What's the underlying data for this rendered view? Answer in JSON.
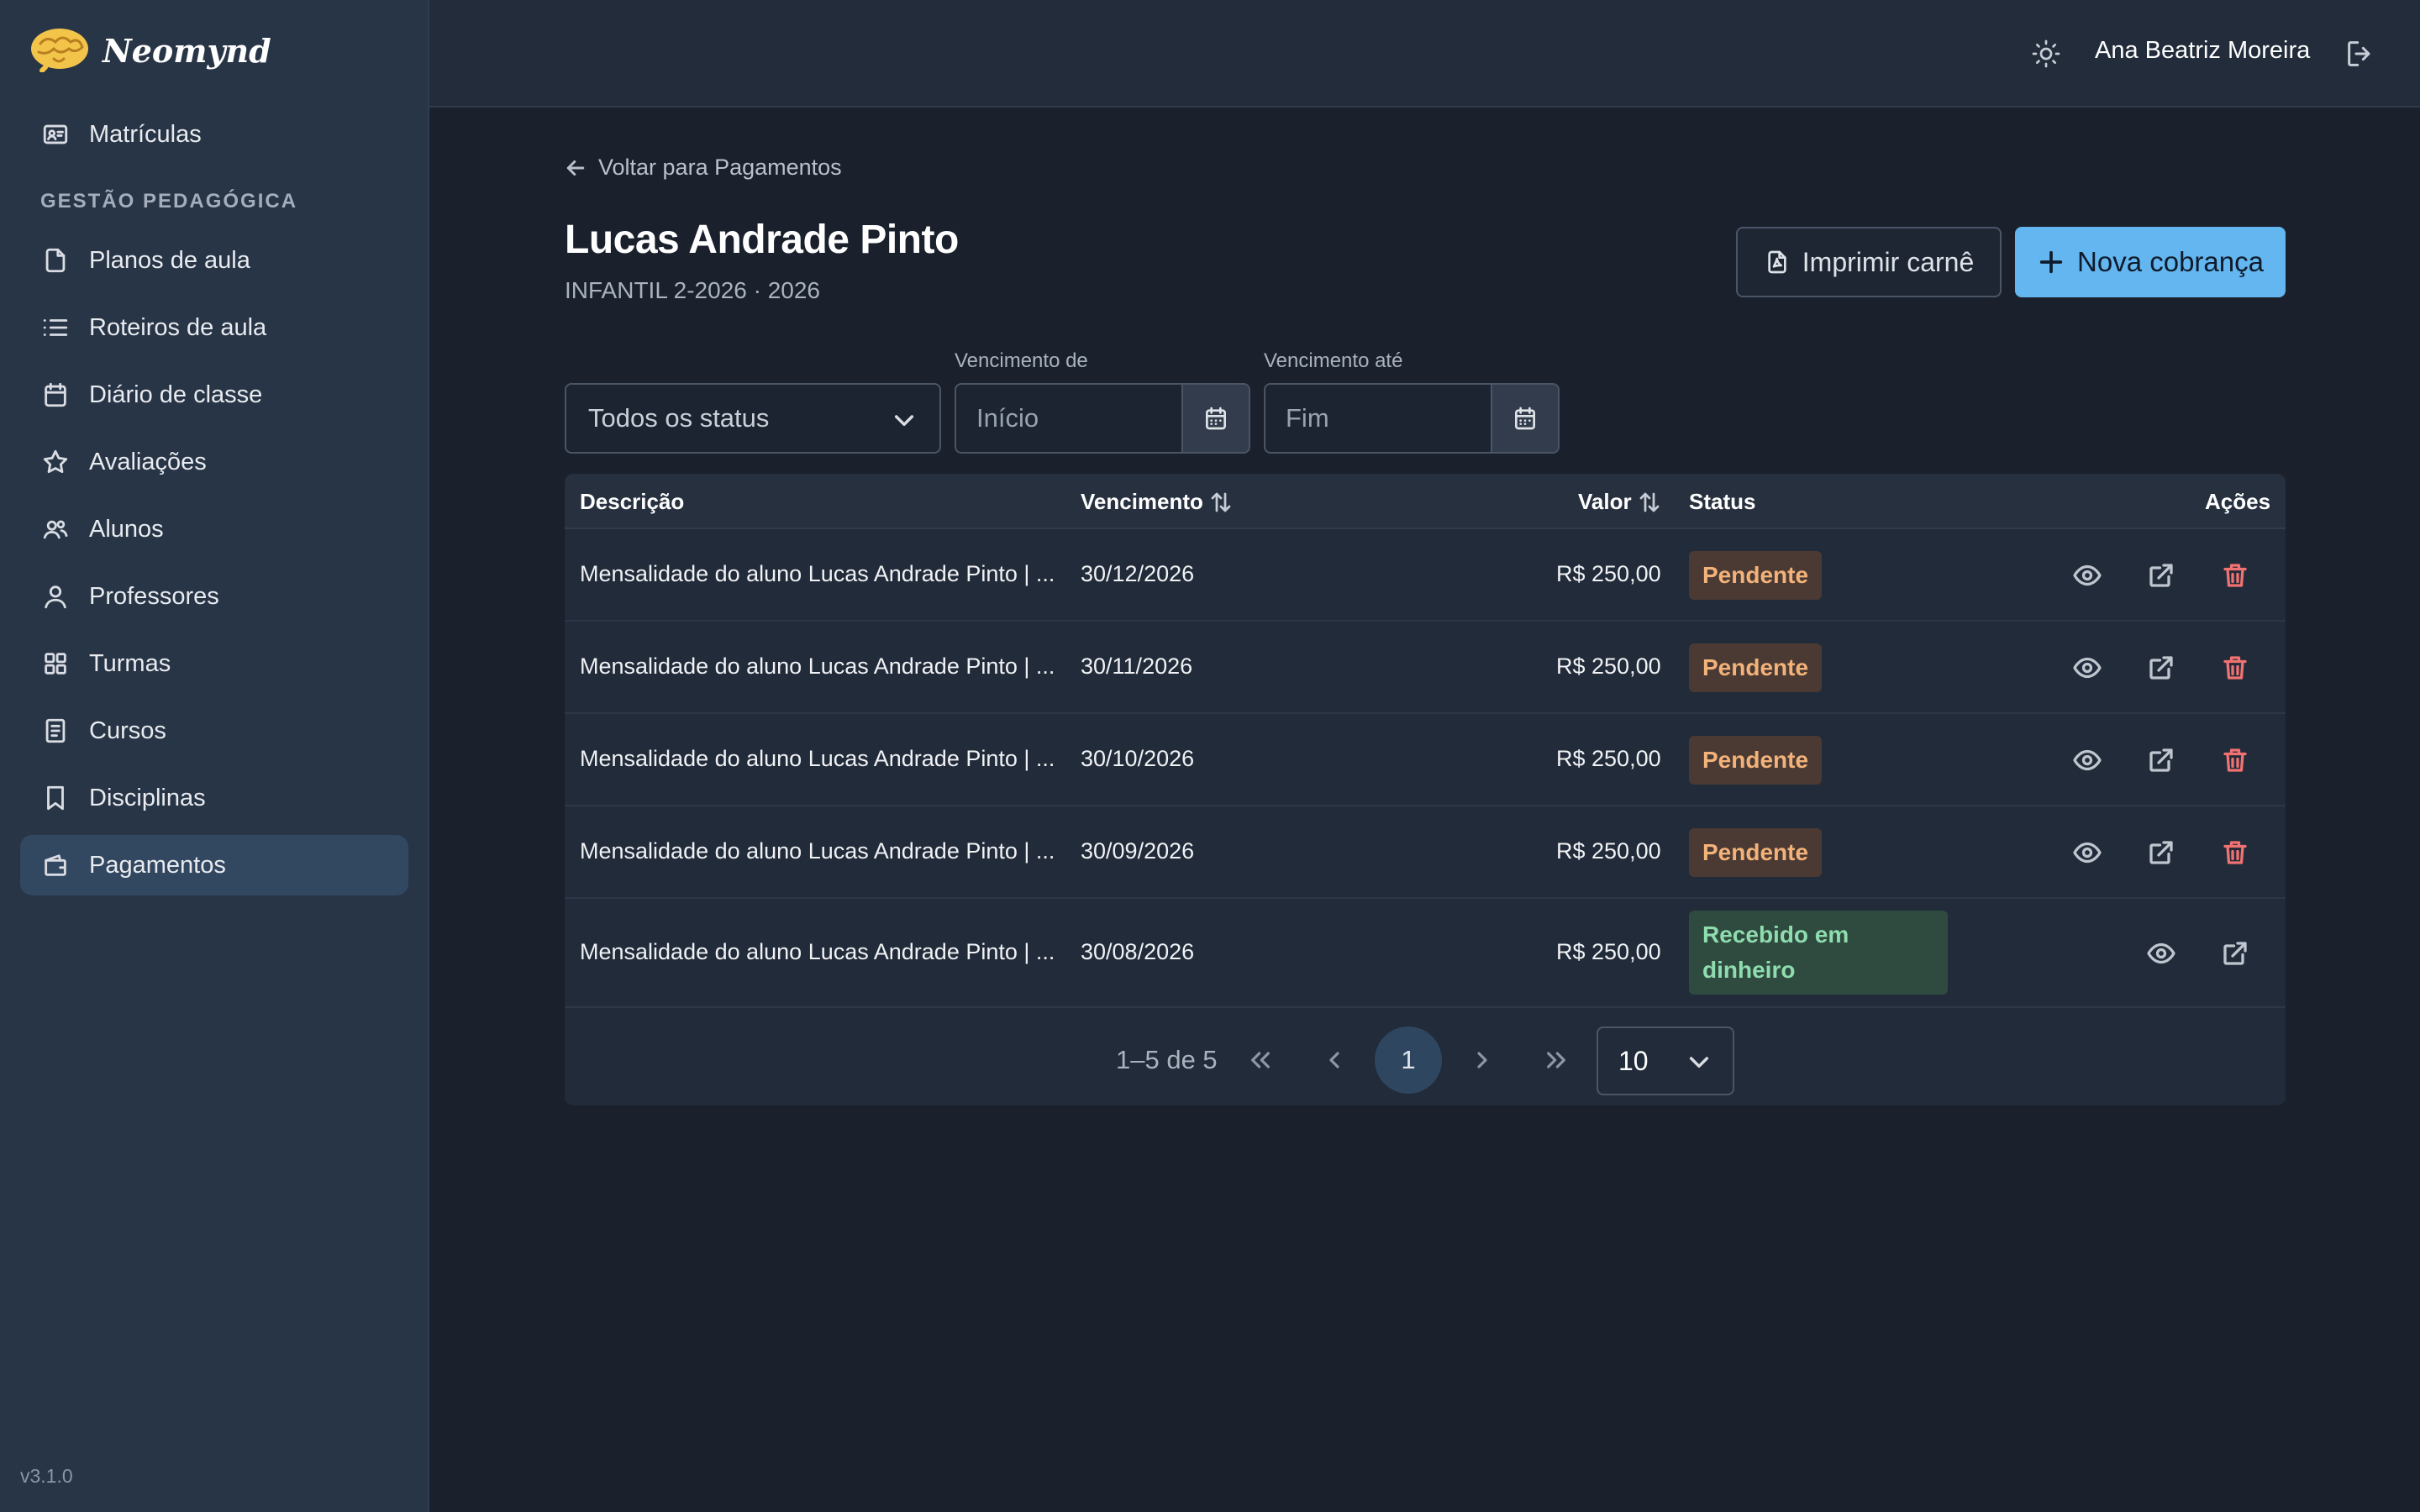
{
  "app": {
    "name": "Neomynd",
    "version": "v3.1.0"
  },
  "topbar": {
    "user_name": "Ana Beatriz Moreira"
  },
  "sidebar": {
    "items_top": [
      {
        "label": "Matrículas",
        "icon": "id-card-icon"
      }
    ],
    "section_title": "GESTÃO PEDAGÓGICA",
    "items": [
      {
        "label": "Planos de aula",
        "icon": "file-icon"
      },
      {
        "label": "Roteiros de aula",
        "icon": "list-icon"
      },
      {
        "label": "Diário de classe",
        "icon": "calendar-icon"
      },
      {
        "label": "Avaliações",
        "icon": "star-icon"
      },
      {
        "label": "Alunos",
        "icon": "users-icon"
      },
      {
        "label": "Professores",
        "icon": "user-icon"
      },
      {
        "label": "Turmas",
        "icon": "grid-icon"
      },
      {
        "label": "Cursos",
        "icon": "book-icon"
      },
      {
        "label": "Disciplinas",
        "icon": "bookmark-icon"
      },
      {
        "label": "Pagamentos",
        "icon": "wallet-icon",
        "active": true
      }
    ]
  },
  "main": {
    "back_link": "Voltar para Pagamentos",
    "title": "Lucas Andrade Pinto",
    "subtitle": "INFANTIL 2-2026 · 2026",
    "print_button": "Imprimir carnê",
    "new_button": "Nova cobrança",
    "filters": {
      "status_value": "Todos os status",
      "due_from_label": "Vencimento de",
      "due_from_placeholder": "Início",
      "due_to_label": "Vencimento até",
      "due_to_placeholder": "Fim"
    }
  },
  "table": {
    "columns": {
      "description": "Descrição",
      "due": "Vencimento",
      "value": "Valor",
      "status": "Status",
      "actions": "Ações"
    },
    "rows": [
      {
        "description": "Mensalidade do aluno Lucas Andrade Pinto | ...",
        "due": "30/12/2026",
        "value": "R$ 250,00",
        "status": "Pendente",
        "status_type": "pending"
      },
      {
        "description": "Mensalidade do aluno Lucas Andrade Pinto | ...",
        "due": "30/11/2026",
        "value": "R$ 250,00",
        "status": "Pendente",
        "status_type": "pending"
      },
      {
        "description": "Mensalidade do aluno Lucas Andrade Pinto | ...",
        "due": "30/10/2026",
        "value": "R$ 250,00",
        "status": "Pendente",
        "status_type": "pending"
      },
      {
        "description": "Mensalidade do aluno Lucas Andrade Pinto | ...",
        "due": "30/09/2026",
        "value": "R$ 250,00",
        "status": "Pendente",
        "status_type": "pending"
      },
      {
        "description": "Mensalidade do aluno Lucas Andrade Pinto | ...",
        "due": "30/08/2026",
        "value": "R$ 250,00",
        "status": "Recebido em dinheiro",
        "status_type": "received"
      }
    ],
    "pagination": {
      "range": "1–5 de 5",
      "current_page": "1",
      "per_page": "10"
    }
  },
  "colors": {
    "background": "#1a202c",
    "sidebar": "#283547",
    "accent": "#63b6f0",
    "pending_text": "#f2b27a",
    "received_text": "#8fdcae",
    "danger": "#f07272"
  }
}
